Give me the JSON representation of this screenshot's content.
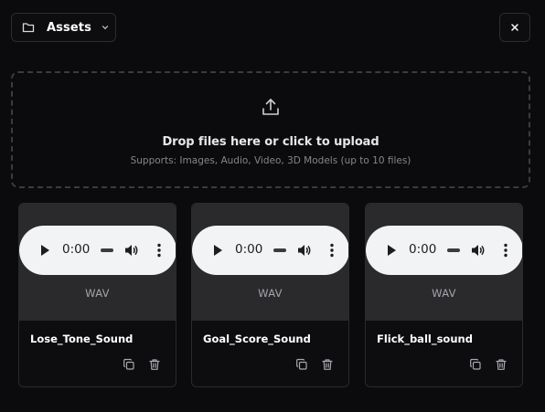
{
  "header": {
    "folder_label": "Assets",
    "folder_icon": "folder-icon",
    "chevron_icon": "chevron-down-icon",
    "close_icon": "close-icon"
  },
  "dropzone": {
    "icon": "upload-icon",
    "title": "Drop files here or click to upload",
    "subtitle": "Supports: Images, Audio, Video, 3D Models (up to 10 files)"
  },
  "assets": [
    {
      "name": "Lose_Tone_Sound",
      "type": "WAV",
      "time": "0:00"
    },
    {
      "name": "Goal_Score_Sound",
      "type": "WAV",
      "time": "0:00"
    },
    {
      "name": "Flick_ball_sound",
      "type": "WAV",
      "time": "0:00"
    }
  ],
  "colors": {
    "background": "#0b0b0d",
    "card_preview": "#2a2a2d",
    "audio_player": "#f1f3f4",
    "border": "#2c2c31"
  }
}
